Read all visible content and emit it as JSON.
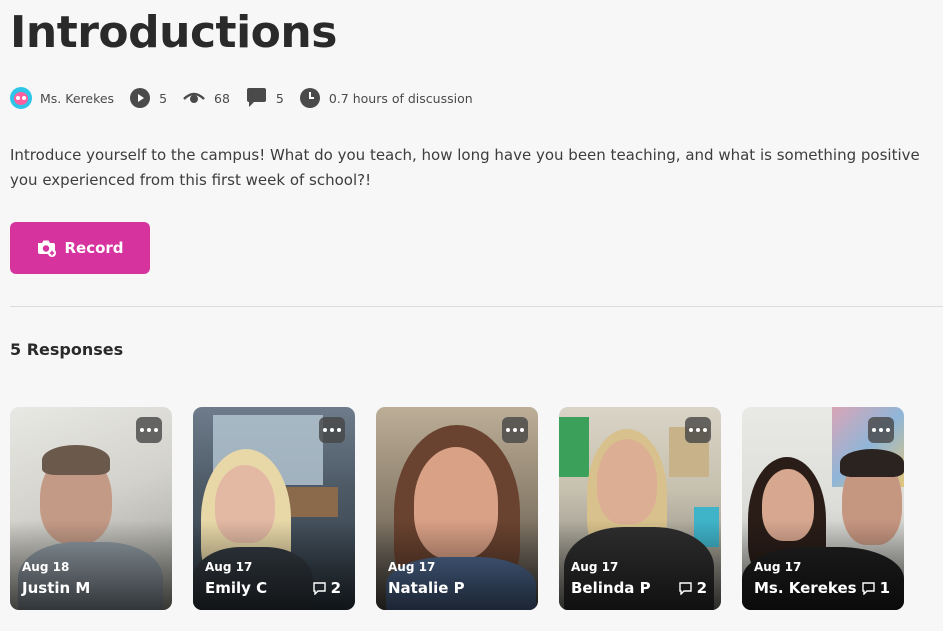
{
  "page": {
    "title": "Introductions",
    "prompt": "Introduce yourself to the campus! What do you teach, how long have you been teaching, and what is something positive you experienced from this first week of school?!"
  },
  "meta": {
    "author": "Ms. Kerekes",
    "videos": "5",
    "views": "68",
    "comments": "5",
    "discussion": "0.7 hours of discussion"
  },
  "record": {
    "label": "Record"
  },
  "responses": {
    "heading": "5 Responses",
    "cards": [
      {
        "date": "Aug 18",
        "name": "Justin M",
        "comments": ""
      },
      {
        "date": "Aug 17",
        "name": "Emily C",
        "comments": "2"
      },
      {
        "date": "Aug 17",
        "name": "Natalie P",
        "comments": ""
      },
      {
        "date": "Aug 17",
        "name": "Belinda P",
        "comments": "2"
      },
      {
        "date": "Aug 17",
        "name": "Ms. Kerekes",
        "comments": "1"
      }
    ]
  },
  "colors": {
    "accent": "#d6339e",
    "background": "#f7f7f7",
    "avatar": "#2ec6e8"
  },
  "icons": {
    "videos": "play-circle-icon",
    "views": "eye-icon",
    "comments": "speech-bubble-icon",
    "discussion": "clock-icon",
    "record": "camera-plus-icon",
    "card_menu": "more-dots-icon",
    "card_comments": "comment-icon"
  }
}
